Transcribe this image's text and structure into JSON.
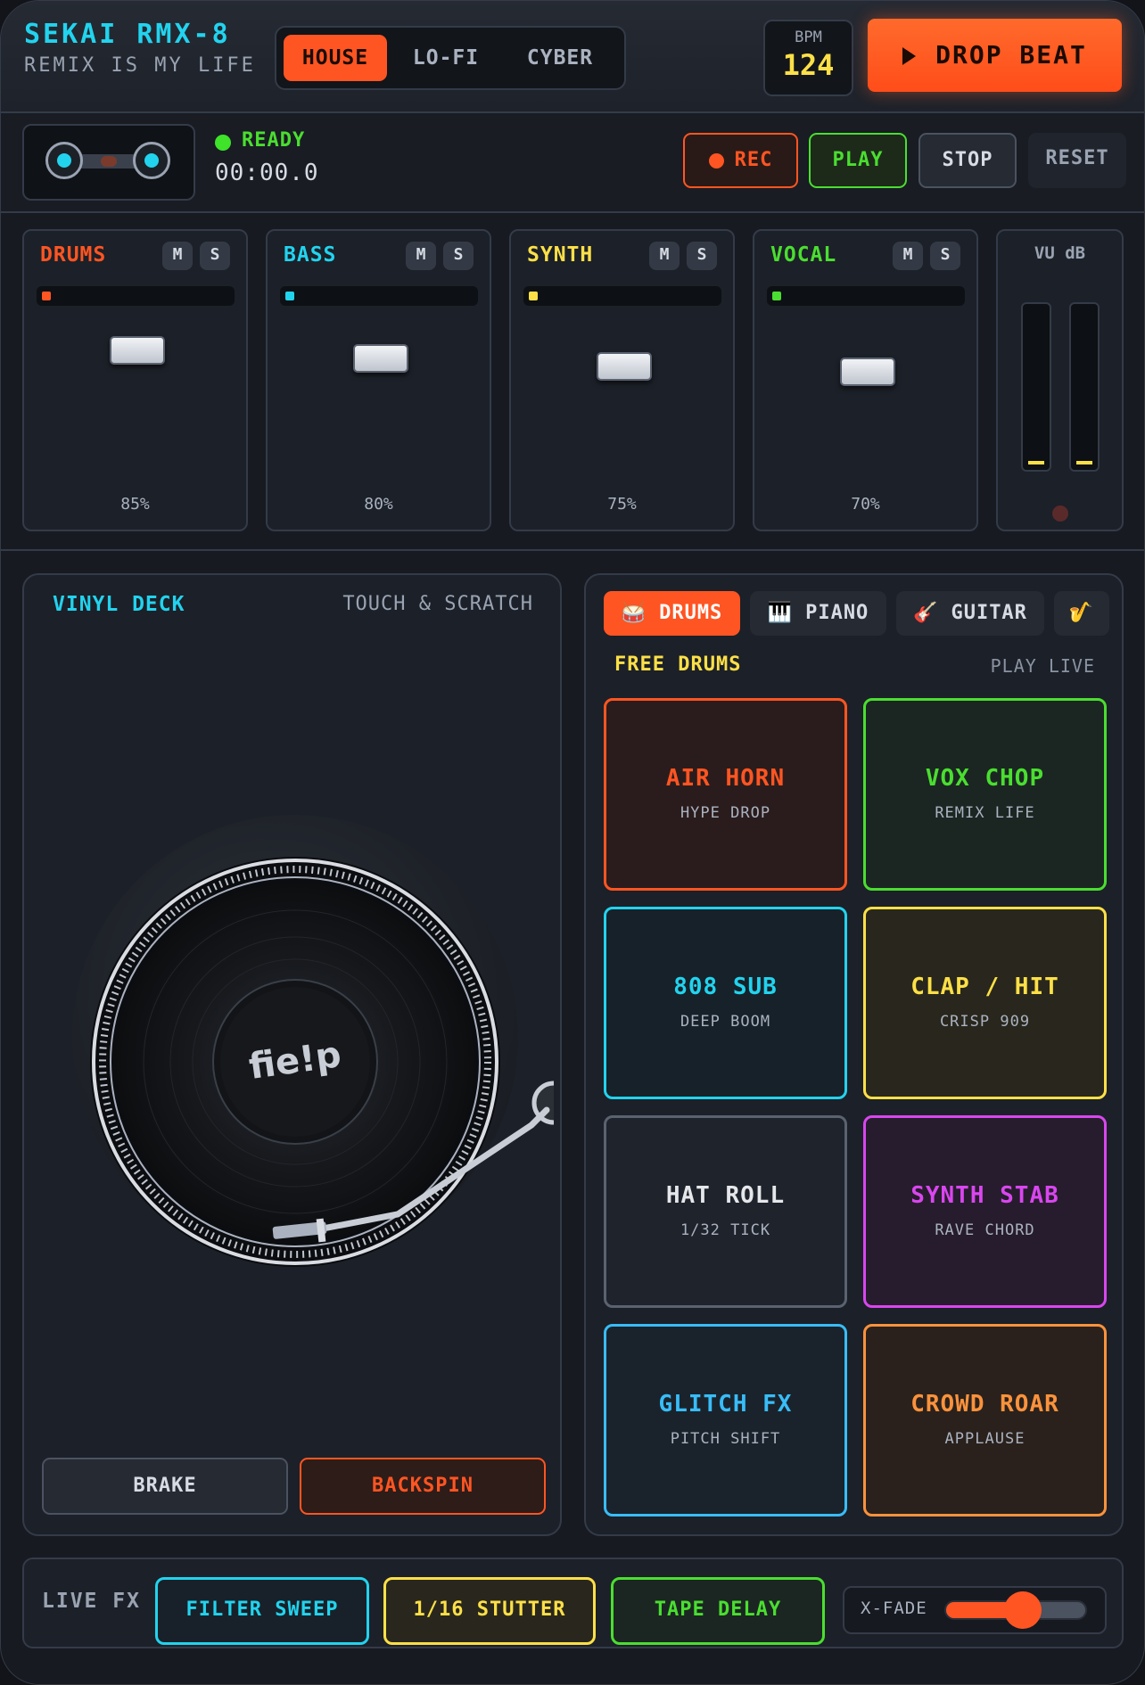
{
  "header": {
    "title": "SEKAI RMX-8",
    "subtitle": "REMIX IS MY LIFE",
    "genres": [
      "HOUSE",
      "LO-FI",
      "CYBER"
    ],
    "active_genre": "HOUSE",
    "bpm_label": "BPM",
    "bpm_value": "124",
    "drop_label": "DROP BEAT"
  },
  "transport": {
    "status": "READY",
    "timer": "00:00.0",
    "rec": "REC",
    "play": "PLAY",
    "stop": "STOP",
    "reset": "RESET"
  },
  "mixer": {
    "channels": [
      {
        "name": "DRUMS",
        "mute": "M",
        "solo": "S",
        "level": "85%",
        "color": "#ff5522"
      },
      {
        "name": "BASS",
        "mute": "M",
        "solo": "S",
        "level": "80%",
        "color": "#22d3ee"
      },
      {
        "name": "SYNTH",
        "mute": "M",
        "solo": "S",
        "level": "75%",
        "color": "#fde047"
      },
      {
        "name": "VOCAL",
        "mute": "M",
        "solo": "S",
        "level": "70%",
        "color": "#4ade30"
      }
    ],
    "vu_label": "VU dB"
  },
  "deck": {
    "title": "VINYL DECK",
    "hint": "TOUCH & SCRATCH",
    "label_text": "fie!p",
    "brake": "BRAKE",
    "backspin": "BACKSPIN"
  },
  "instruments": {
    "tabs": [
      {
        "icon": "drum-icon",
        "glyph": "🥁",
        "label": "DRUMS"
      },
      {
        "icon": "piano-icon",
        "glyph": "🎹",
        "label": "PIANO"
      },
      {
        "icon": "guitar-icon",
        "glyph": "🎸",
        "label": "GUITAR"
      },
      {
        "icon": "saxophone-icon",
        "glyph": "🎷",
        "label": ""
      }
    ],
    "active": "DRUMS",
    "heading": "FREE DRUMS",
    "hint": "PLAY LIVE"
  },
  "pads": [
    {
      "name": "AIR HORN",
      "sub": "HYPE DROP",
      "color": "#ff5522"
    },
    {
      "name": "VOX CHOP",
      "sub": "REMIX LIFE",
      "color": "#4ade30"
    },
    {
      "name": "808 SUB",
      "sub": "DEEP BOOM",
      "color": "#22d3ee"
    },
    {
      "name": "CLAP / HIT",
      "sub": "CRISP 909",
      "color": "#fde047"
    },
    {
      "name": "HAT ROLL",
      "sub": "1/32 TICK",
      "color": "#e5e7eb"
    },
    {
      "name": "SYNTH STAB",
      "sub": "RAVE CHORD",
      "color": "#d946ef"
    },
    {
      "name": "GLITCH FX",
      "sub": "PITCH SHIFT",
      "color": "#38bdf8"
    },
    {
      "name": "CROWD ROAR",
      "sub": "APPLAUSE",
      "color": "#fb923c"
    }
  ],
  "fx": {
    "label": "LIVE FX",
    "buttons": [
      {
        "label": "FILTER SWEEP",
        "color": "#22d3ee"
      },
      {
        "label": "1/16 STUTTER",
        "color": "#fde047"
      },
      {
        "label": "TAPE DELAY",
        "color": "#4ade30"
      }
    ],
    "xfade_label": "X-FADE",
    "xfade_value": 0.5
  }
}
